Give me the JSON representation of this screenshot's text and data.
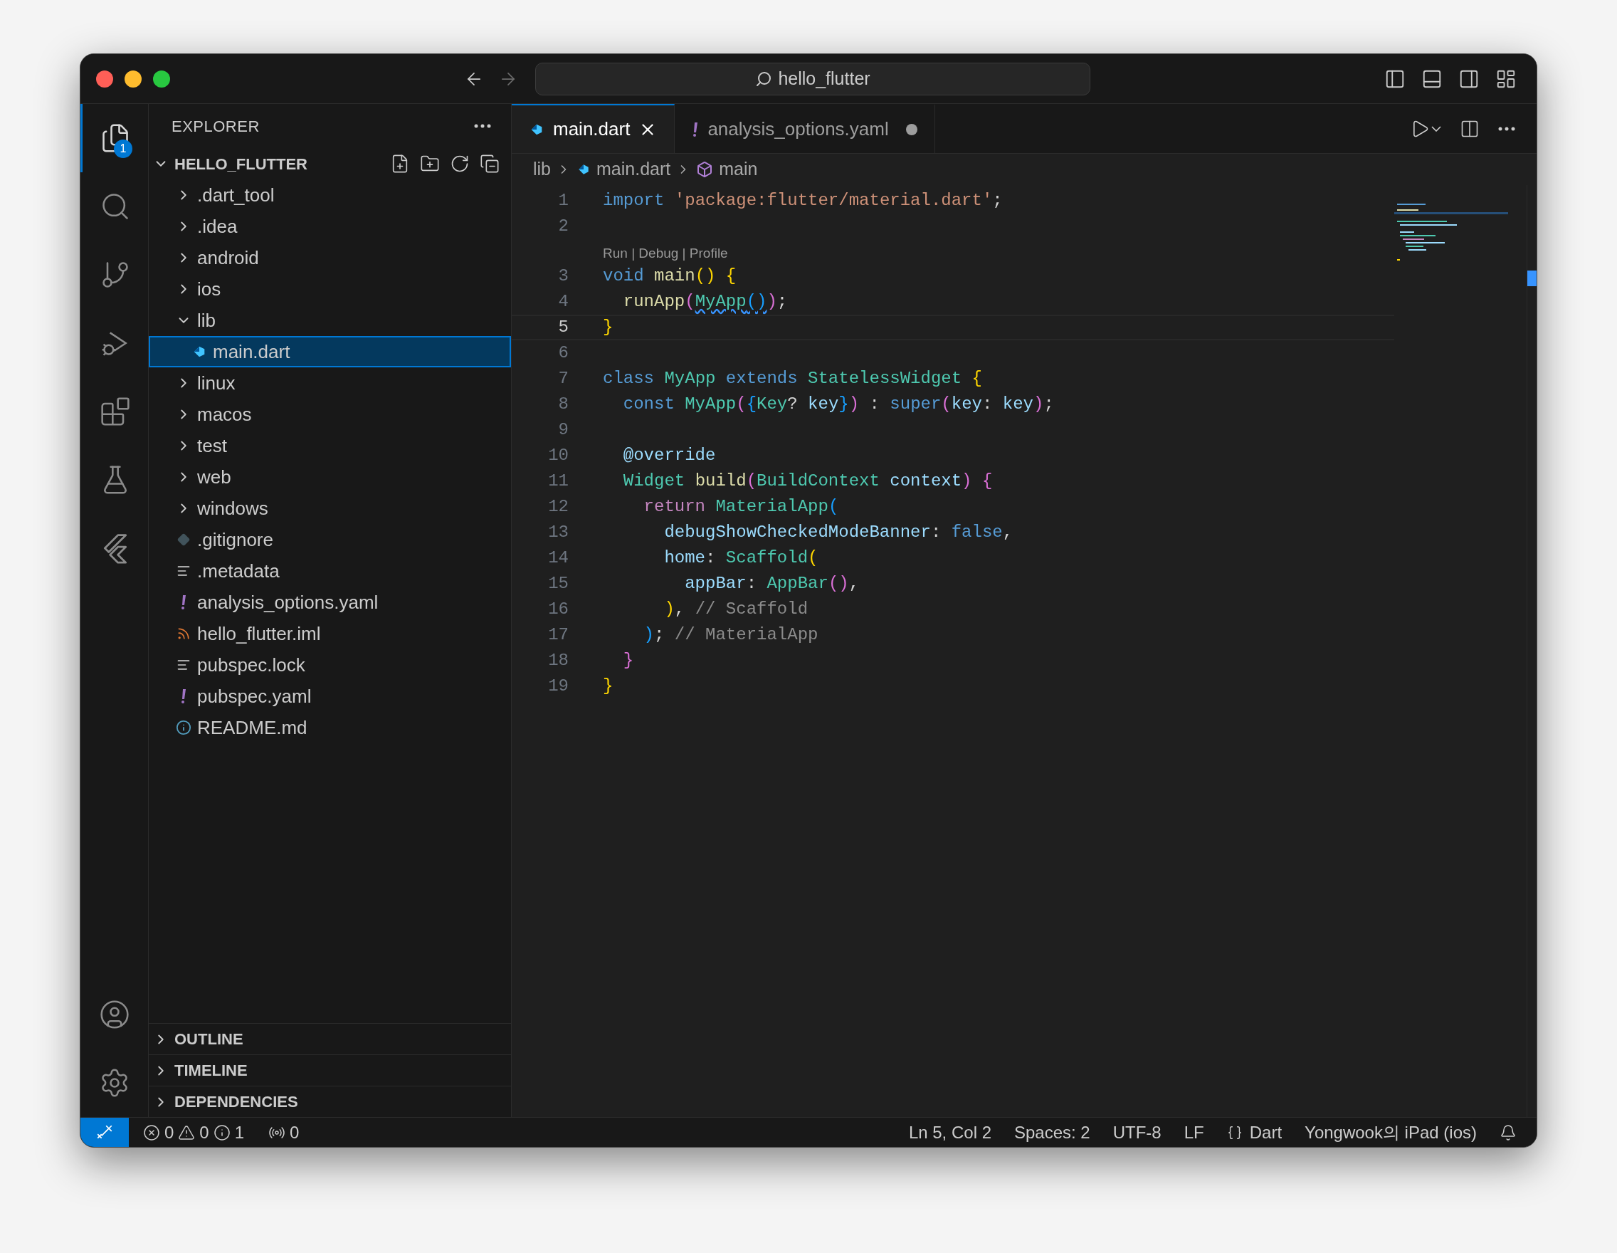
{
  "window": {
    "title": "hello_flutter"
  },
  "activity_bar": {
    "items": [
      {
        "kind": "explorer",
        "selected": true,
        "badge": "1"
      },
      {
        "kind": "search",
        "selected": false
      },
      {
        "kind": "source_control",
        "selected": false
      },
      {
        "kind": "run_debug",
        "selected": false
      },
      {
        "kind": "extensions",
        "selected": false
      },
      {
        "kind": "testing",
        "selected": false
      },
      {
        "kind": "flutter",
        "selected": false
      }
    ],
    "bottom": [
      {
        "kind": "account"
      },
      {
        "kind": "settings"
      }
    ]
  },
  "sidebar": {
    "title": "EXPLORER",
    "folder": {
      "name": "HELLO_FLUTTER",
      "expanded": true
    },
    "items": [
      {
        "kind": "folder",
        "name": ".dart_tool",
        "expanded": false,
        "selected": false
      },
      {
        "kind": "folder",
        "name": ".idea",
        "expanded": false,
        "selected": false
      },
      {
        "kind": "folder",
        "name": "android",
        "expanded": false,
        "selected": false
      },
      {
        "kind": "folder",
        "name": "ios",
        "expanded": false,
        "selected": false
      },
      {
        "kind": "folder",
        "name": "lib",
        "expanded": true,
        "selected": false,
        "children": [
          {
            "kind": "dart",
            "name": "main.dart",
            "selected": true
          }
        ]
      },
      {
        "kind": "folder",
        "name": "linux",
        "expanded": false,
        "selected": false
      },
      {
        "kind": "folder",
        "name": "macos",
        "expanded": false,
        "selected": false
      },
      {
        "kind": "folder",
        "name": "test",
        "expanded": false,
        "selected": false
      },
      {
        "kind": "folder",
        "name": "web",
        "expanded": false,
        "selected": false
      },
      {
        "kind": "folder",
        "name": "windows",
        "expanded": false,
        "selected": false
      },
      {
        "kind": "git",
        "name": ".gitignore",
        "selected": false
      },
      {
        "kind": "text",
        "name": ".metadata",
        "selected": false
      },
      {
        "kind": "yaml",
        "name": "analysis_options.yaml",
        "selected": false
      },
      {
        "kind": "xml",
        "name": "hello_flutter.iml",
        "selected": false
      },
      {
        "kind": "text",
        "name": "pubspec.lock",
        "selected": false
      },
      {
        "kind": "yaml",
        "name": "pubspec.yaml",
        "selected": false
      },
      {
        "kind": "info",
        "name": "README.md",
        "selected": false
      }
    ],
    "sections": [
      {
        "name": "OUTLINE",
        "expanded": false
      },
      {
        "name": "TIMELINE",
        "expanded": false
      },
      {
        "name": "DEPENDENCIES",
        "expanded": false
      }
    ]
  },
  "tabs": [
    {
      "label": "main.dart",
      "kind": "dart",
      "selected": true,
      "modified": false
    },
    {
      "label": "analysis_options.yaml",
      "kind": "yaml",
      "selected": false,
      "modified": true
    }
  ],
  "breadcrumbs": [
    {
      "kind": "folder",
      "label": "lib"
    },
    {
      "kind": "dart",
      "label": "main.dart"
    },
    {
      "kind": "symbol",
      "label": "main"
    }
  ],
  "code": [
    {
      "number": "1",
      "current": false,
      "tokens": [
        {
          "text": "import ",
          "kind": "keyword"
        },
        {
          "text": "'package:flutter/material.dart'",
          "kind": "string"
        },
        {
          "text": ";",
          "kind": "plain"
        }
      ]
    },
    {
      "number": "2",
      "current": false
    },
    {
      "number": "3",
      "current": false,
      "codelens": "Run | Debug | Profile",
      "tokens": [
        {
          "text": "void ",
          "kind": "keyword"
        },
        {
          "text": "main",
          "kind": "function"
        },
        {
          "text": "() {",
          "kind": "bracket1"
        }
      ]
    },
    {
      "number": "4",
      "current": false,
      "tokens": [
        {
          "text": "  runApp",
          "kind": "function"
        },
        {
          "text": "(",
          "kind": "bracket2"
        },
        {
          "text": "MyApp",
          "kind": "type_warn"
        },
        {
          "text": "()",
          "kind": "bracket3_warn"
        },
        {
          "text": ")",
          "kind": "bracket2"
        },
        {
          "text": ";",
          "kind": "plain"
        }
      ]
    },
    {
      "number": "5",
      "current": true,
      "tokens": [
        {
          "text": "}",
          "kind": "bracket1"
        }
      ]
    },
    {
      "number": "6",
      "current": false
    },
    {
      "number": "7",
      "current": false,
      "tokens": [
        {
          "text": "class ",
          "kind": "keyword"
        },
        {
          "text": "MyApp ",
          "kind": "type"
        },
        {
          "text": "extends ",
          "kind": "keyword"
        },
        {
          "text": "StatelessWidget ",
          "kind": "type"
        },
        {
          "text": "{",
          "kind": "bracket1"
        }
      ]
    },
    {
      "number": "8",
      "current": false,
      "tokens": [
        {
          "text": "  const ",
          "kind": "keyword"
        },
        {
          "text": "MyApp",
          "kind": "type"
        },
        {
          "text": "(",
          "kind": "bracket2"
        },
        {
          "text": "{",
          "kind": "bracket3"
        },
        {
          "text": "Key",
          "kind": "type"
        },
        {
          "text": "? ",
          "kind": "plain"
        },
        {
          "text": "key",
          "kind": "variable"
        },
        {
          "text": "}",
          "kind": "bracket3"
        },
        {
          "text": ")",
          "kind": "bracket2"
        },
        {
          "text": " : ",
          "kind": "plain"
        },
        {
          "text": "super",
          "kind": "keyword"
        },
        {
          "text": "(",
          "kind": "bracket2"
        },
        {
          "text": "key",
          "kind": "variable"
        },
        {
          "text": ": ",
          "kind": "plain"
        },
        {
          "text": "key",
          "kind": "variable"
        },
        {
          "text": ")",
          "kind": "bracket2"
        },
        {
          "text": ";",
          "kind": "plain"
        }
      ]
    },
    {
      "number": "9",
      "current": false
    },
    {
      "number": "10",
      "current": false,
      "tokens": [
        {
          "text": "  @override",
          "kind": "variable"
        }
      ]
    },
    {
      "number": "11",
      "current": false,
      "tokens": [
        {
          "text": "  Widget ",
          "kind": "type"
        },
        {
          "text": "build",
          "kind": "function"
        },
        {
          "text": "(",
          "kind": "bracket2"
        },
        {
          "text": "BuildContext ",
          "kind": "type"
        },
        {
          "text": "context",
          "kind": "variable"
        },
        {
          "text": ") {",
          "kind": "bracket2"
        }
      ]
    },
    {
      "number": "12",
      "current": false,
      "tokens": [
        {
          "text": "    return ",
          "kind": "control"
        },
        {
          "text": "MaterialApp",
          "kind": "type"
        },
        {
          "text": "(",
          "kind": "bracket3"
        }
      ]
    },
    {
      "number": "13",
      "current": false,
      "tokens": [
        {
          "text": "      debugShowCheckedModeBanner",
          "kind": "variable"
        },
        {
          "text": ": ",
          "kind": "plain"
        },
        {
          "text": "false",
          "kind": "keyword"
        },
        {
          "text": ",",
          "kind": "plain"
        }
      ]
    },
    {
      "number": "14",
      "current": false,
      "tokens": [
        {
          "text": "      home",
          "kind": "variable"
        },
        {
          "text": ": ",
          "kind": "plain"
        },
        {
          "text": "Scaffold",
          "kind": "type"
        },
        {
          "text": "(",
          "kind": "bracket1"
        }
      ]
    },
    {
      "number": "15",
      "current": false,
      "tokens": [
        {
          "text": "        appBar",
          "kind": "variable"
        },
        {
          "text": ": ",
          "kind": "plain"
        },
        {
          "text": "AppBar",
          "kind": "type"
        },
        {
          "text": "()",
          "kind": "bracket2"
        },
        {
          "text": ",",
          "kind": "plain"
        }
      ]
    },
    {
      "number": "16",
      "current": false,
      "tokens": [
        {
          "text": "      )",
          "kind": "bracket1"
        },
        {
          "text": ", ",
          "kind": "plain"
        },
        {
          "text": "// Scaffold",
          "kind": "comment"
        }
      ]
    },
    {
      "number": "17",
      "current": false,
      "tokens": [
        {
          "text": "    )",
          "kind": "bracket3"
        },
        {
          "text": "; ",
          "kind": "plain"
        },
        {
          "text": "// MaterialApp",
          "kind": "comment"
        }
      ]
    },
    {
      "number": "18",
      "current": false,
      "tokens": [
        {
          "text": "  }",
          "kind": "bracket2"
        }
      ]
    },
    {
      "number": "19",
      "current": false,
      "tokens": [
        {
          "text": "}",
          "kind": "bracket1"
        }
      ]
    }
  ],
  "status_bar": {
    "errors": "0",
    "warnings": "0",
    "infos": "1",
    "ports": "0",
    "right": [
      {
        "kind": "text",
        "label": "Ln 5, Col 2"
      },
      {
        "kind": "text",
        "label": "Spaces: 2"
      },
      {
        "kind": "text",
        "label": "UTF-8"
      },
      {
        "kind": "text",
        "label": "LF"
      },
      {
        "kind": "language",
        "label": "Dart"
      },
      {
        "kind": "text",
        "label": "Yongwook의 iPad (ios)"
      },
      {
        "kind": "bell"
      }
    ]
  }
}
